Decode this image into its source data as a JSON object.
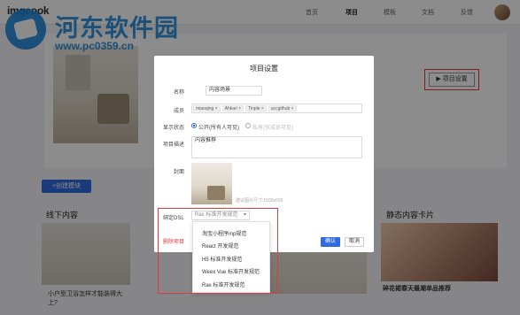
{
  "app": {
    "logo": "imgcook"
  },
  "nav": [
    "首页",
    "项目",
    "模板",
    "文档",
    "反馈"
  ],
  "watermark": {
    "title": "河东软件园",
    "url": "www.pc0359.cn"
  },
  "page": {
    "settings_button": "▶ 项目设置",
    "create_module_button": "+创建模块",
    "sections": [
      "线下内容",
      "静态内容卡片"
    ],
    "left_caption": "小户型卫浴怎样才能装得大上?",
    "right_caption": "碎花裙春天最潮单品推荐"
  },
  "modal": {
    "title": "项目设置",
    "name_label": "名称",
    "name_value": "内容场景",
    "members_label": "成员",
    "members": [
      "miaoqing",
      "Ahkari",
      "Tinple",
      "accgithub"
    ],
    "visibility_label": "显示状态",
    "visibility_public": "公开(所有人可见)",
    "visibility_private": "私有(仅成员可见)",
    "description_label": "项目描述",
    "description_value": "内容推荐",
    "cover_label": "封面",
    "cover_hint": "建议图片尺寸:1500x500",
    "dsl_label": "绑定DSL",
    "dsl_value": "Rax 标准开发规范",
    "delete_label": "删除项目",
    "ok_button": "确认",
    "cancel_button": "取消"
  },
  "dsl_options": [
    "淘宝小程序mp规范",
    "React 开发规范",
    "H5 标准开发规范",
    "Weex Vue 标准开发规范",
    "Rax 标准开发规范"
  ],
  "colors": {
    "accent": "#2f6be0",
    "highlight": "#e0393f",
    "watermark": "#1e88d8"
  }
}
